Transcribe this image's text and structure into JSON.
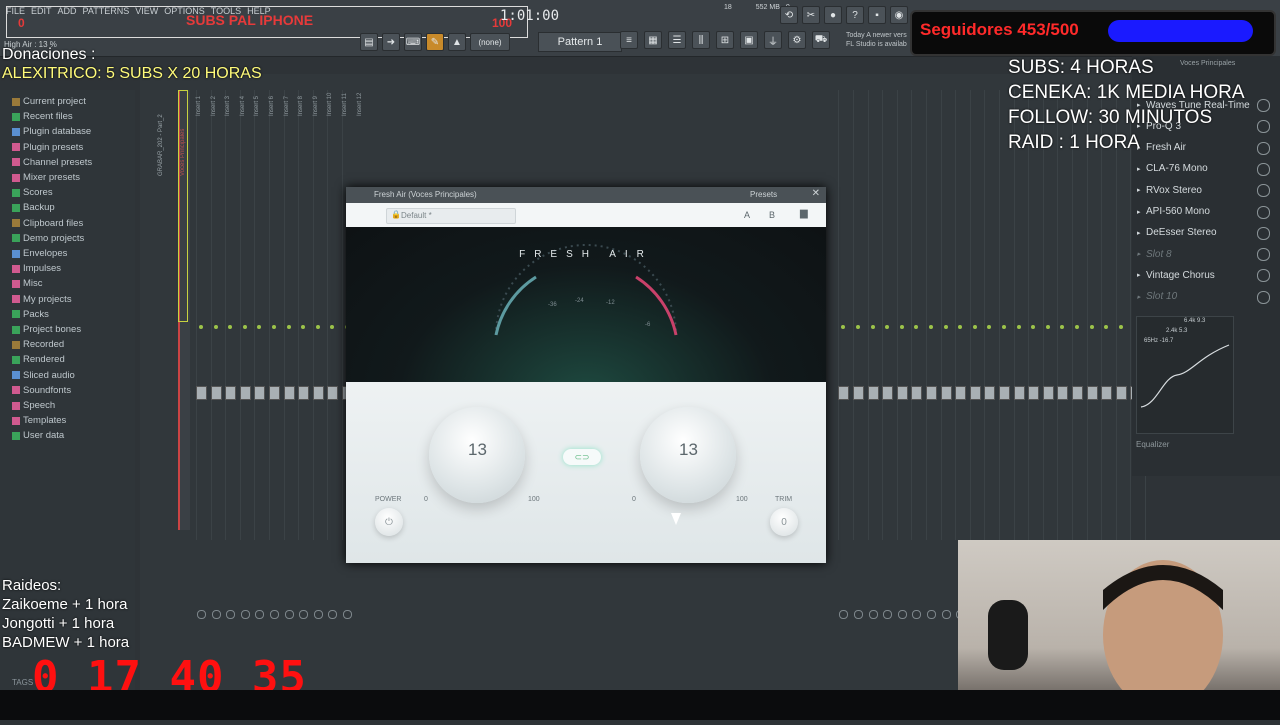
{
  "menu": {
    "items": [
      "FILE",
      "EDIT",
      "ADD",
      "PATTERNS",
      "VIEW",
      "OPTIONS",
      "TOOLS",
      "HELP"
    ]
  },
  "overlay_top": {
    "title": "SUBS PAL IPHONE",
    "left_num": "0",
    "right_num": "100"
  },
  "transport": {
    "time": "1:01:00",
    "cpu": "18",
    "memory": "552 MB",
    "voices": "0"
  },
  "pattern": {
    "label": "Pattern 1",
    "snap": "(none)"
  },
  "hint": {
    "line1": "Today   A newer vers",
    "line2": "FL Studio is availab"
  },
  "followers": {
    "label": "Seguidores 453/500",
    "progress": 0.906,
    "color": "#ff2a2a",
    "bar_color": "#1a1aff"
  },
  "donaciones": {
    "title": "Donaciones :",
    "line": "ALEXITRICO: 5 SUBS X 20 HORAS"
  },
  "subs_info": [
    "SUBS: 4 HORAS",
    "CENEKA: 1K MEDIA HORA",
    "FOLLOW: 30 MINUTOS",
    "RAID : 1 HORA"
  ],
  "raideos": {
    "title": "Raideos:",
    "lines": [
      "Zaikoeme + 1 hora",
      "Jongotti + 1 hora",
      "BADMEW + 1 hora"
    ]
  },
  "counter": {
    "value": "0 17 40 35"
  },
  "browser": {
    "hint": "High Air : 13 %",
    "items": [
      "Current project",
      "Recent files",
      "Plugin database",
      "Plugin presets",
      "Channel presets",
      "Mixer presets",
      "Scores",
      "Backup",
      "Clipboard files",
      "Demo projects",
      "Envelopes",
      "Impulses",
      "Misc",
      "My projects",
      "Packs",
      "Project bones",
      "Recorded",
      "Rendered",
      "Sliced audio",
      "Soundfonts",
      "Speech",
      "Templates",
      "User data"
    ],
    "tags_label": "TAGS"
  },
  "mixer": {
    "insert_labels": [
      "Insert 1",
      "Insert 2",
      "Insert 3",
      "Insert 4",
      "Insert 5",
      "Insert 6",
      "Insert 7",
      "Insert 8",
      "Insert 9",
      "Insert 10",
      "Insert 11",
      "Insert 12"
    ],
    "master_label": "Voces Principales",
    "track_label": "GRABAR_202 - Part_2"
  },
  "mixer_panel": {
    "title": "Voces Principales",
    "slots": [
      {
        "name": "Waves Tune Real-Time",
        "dim": false
      },
      {
        "name": "Pro-Q 3",
        "dim": false
      },
      {
        "name": "Fresh Air",
        "dim": false
      },
      {
        "name": "CLA-76 Mono",
        "dim": false
      },
      {
        "name": "RVox Stereo",
        "dim": false
      },
      {
        "name": "API-560 Mono",
        "dim": false
      },
      {
        "name": "DeEsser Stereo",
        "dim": false
      },
      {
        "name": "Slot 8",
        "dim": true
      },
      {
        "name": "Vintage Chorus",
        "dim": false
      },
      {
        "name": "Slot 10",
        "dim": true
      }
    ],
    "eq_label": "Equalizer",
    "eq_readout": "6.4k 9.3",
    "eq_readout2": "2.4k 5.3",
    "eq_readout3": "65Hz -16.7"
  },
  "plugin": {
    "window_title": "Fresh Air (Voces Principales)",
    "presets_label": "Presets",
    "preset_name": "Default *",
    "ab_a": "A",
    "ab_b": "B",
    "name": "FRESH AIR",
    "meter_ticks": [
      "-36",
      "-24",
      "-12",
      "-6"
    ],
    "left_knob": {
      "value": "13",
      "min": "0",
      "max": "100"
    },
    "right_knob": {
      "value": "13",
      "min": "0",
      "max": "100"
    },
    "power_label": "POWER",
    "trim_label": "TRIM",
    "trim_value": "0"
  }
}
